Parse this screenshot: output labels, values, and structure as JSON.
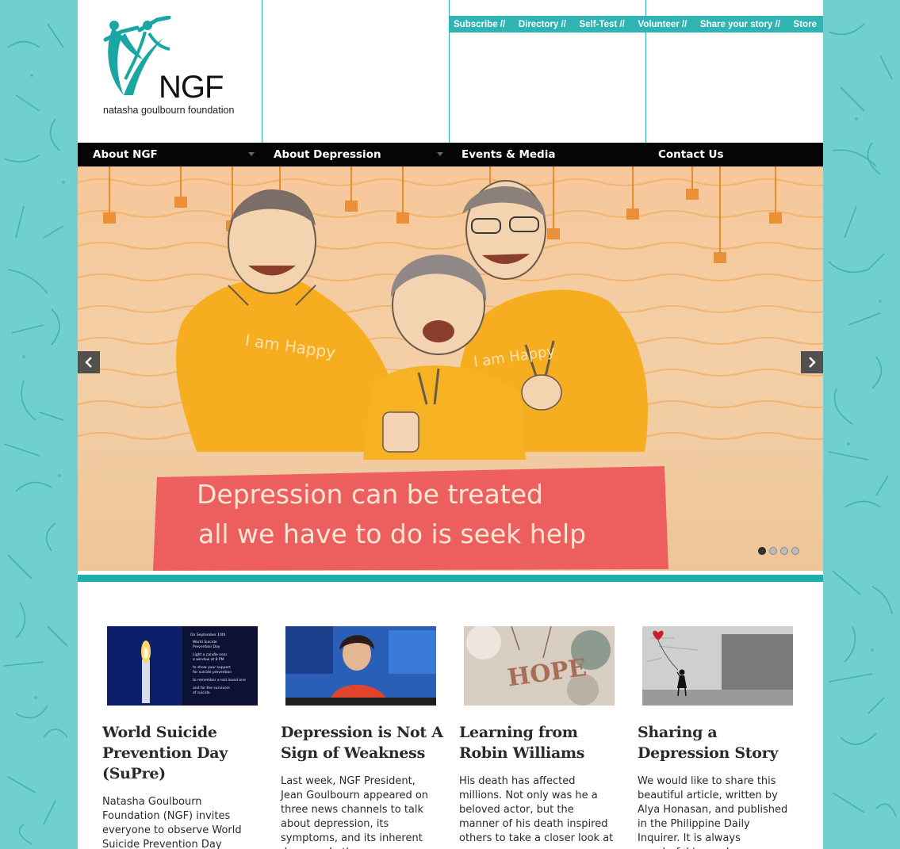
{
  "colors": {
    "teal": "#2fb3b3",
    "nav_bg": "#050505",
    "page_bg": "#6fd0cd"
  },
  "logo": {
    "mark": "NGF",
    "name": "natasha goulbourn foundation",
    "icon": "dancing-figures-icon"
  },
  "top_nav": [
    {
      "label": "Subscribe //"
    },
    {
      "label": "Directory //"
    },
    {
      "label": "Self-Test //"
    },
    {
      "label": "Volunteer //"
    },
    {
      "label": "Share your story //"
    },
    {
      "label": "Store"
    }
  ],
  "main_nav": [
    {
      "label": "About NGF",
      "has_dropdown": true
    },
    {
      "label": "About Depression",
      "has_dropdown": true
    },
    {
      "label": "Events & Media",
      "has_dropdown": false
    },
    {
      "label": "Contact Us",
      "has_dropdown": false
    }
  ],
  "slider": {
    "shirt_text": "I am Happy",
    "caption_line1": "Depression can be treated",
    "caption_line2": "all we have to do is seek help",
    "prev_icon": "chevron-left-icon",
    "next_icon": "chevron-right-icon",
    "slide_count": 4,
    "active_slide": 1
  },
  "thumb1": {
    "lines": [
      "On September 10th",
      "World Suicide",
      "Prevention Day",
      "Light a candle near",
      "a window at 8 PM",
      "to show your support",
      "for suicide prevention",
      "to remember a lost loved one",
      "and for the survivors",
      "of suicide."
    ]
  },
  "thumb3": {
    "word": "HOPE"
  },
  "articles": [
    {
      "title": "World Suicide Prevention Day (SuPre)",
      "excerpt": "Natasha Goulbourn Foundation (NGF) invites everyone to observe World Suicide Prevention Day (SuPre)"
    },
    {
      "title": "Depression is Not A Sign of Weakness",
      "excerpt": "Last week, NGF President, Jean Goulbourn appeared on three news channels to talk about depression, its symptoms, and its inherent dangers. In these"
    },
    {
      "title": "Learning from Robin Williams",
      "excerpt": "His death has affected millions. Not only was he a beloved actor, but the manner of his death inspired others to take a closer look at"
    },
    {
      "title": "Sharing a Depression Story",
      "excerpt": "We would like to share this beautiful article, written by Alya Honasan, and published in the Philippine Daily Inquirer. It is always wonderful to read"
    }
  ]
}
